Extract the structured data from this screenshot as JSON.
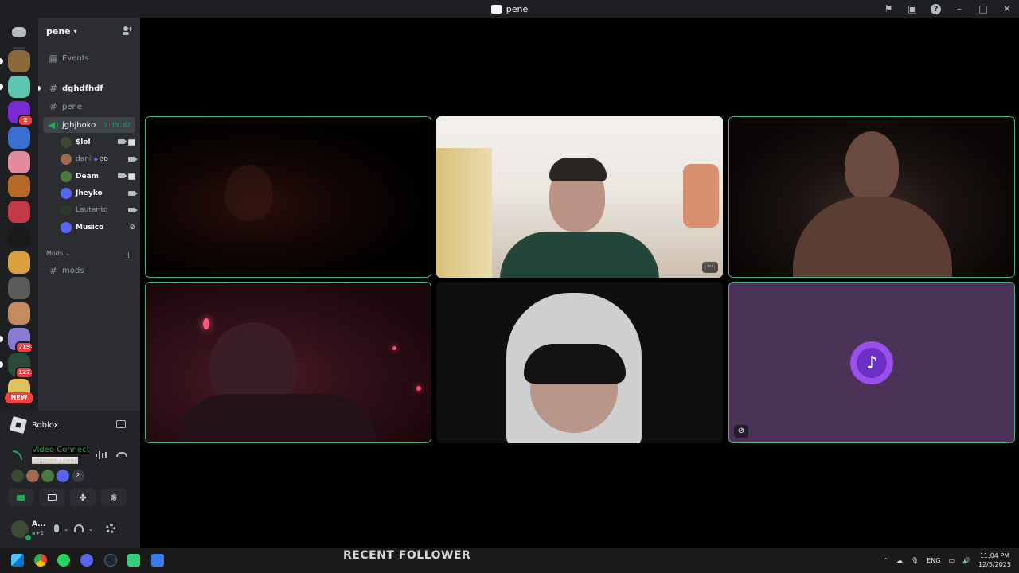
{
  "titlebar": {
    "title": "pene"
  },
  "server": {
    "name": "pene",
    "events_label": "Events",
    "channels": [
      {
        "name": "dghdfhdf",
        "type": "text",
        "unread": true
      },
      {
        "name": "pene",
        "type": "text",
        "unread": false
      },
      {
        "name": "jghjhoko",
        "type": "voice",
        "timer": "1:19:02"
      }
    ],
    "voice_users": [
      {
        "name": "$lol",
        "bold": true,
        "camera": true,
        "screen": true
      },
      {
        "name": "dani",
        "bold": false,
        "badge": "GD",
        "camera": true
      },
      {
        "name": "Deam",
        "bold": true,
        "camera": true,
        "screen": true
      },
      {
        "name": "Jheyko",
        "bold": true,
        "camera": true
      },
      {
        "name": "Lautarito",
        "bold": false,
        "camera": true
      },
      {
        "name": "Musico",
        "bold": true,
        "activity": true
      }
    ],
    "category": "Mods",
    "category_channels": [
      {
        "name": "mods"
      }
    ]
  },
  "servers": [
    {
      "color": "#8a6a3a"
    },
    {
      "color": "#5fc4b0"
    },
    {
      "color": "#7a2ad4",
      "badge": "2"
    },
    {
      "color": "#3a6fd0"
    },
    {
      "color": "#e38aa0"
    },
    {
      "color": "#b56a2a"
    },
    {
      "color": "#c23a4a"
    },
    {
      "color": "#1a1a1a"
    },
    {
      "color": "#d8a040"
    },
    {
      "color": "#5a5a5a"
    },
    {
      "color": "#c48a60"
    },
    {
      "color": "#8a7ad0",
      "badge": "719"
    },
    {
      "color": "#2a4a3a",
      "badge": "127"
    },
    {
      "color": "#e0c060"
    }
  ],
  "new_badge": "NEW",
  "activity": {
    "game": "Roblox"
  },
  "voice_panel": {
    "status": "Video Connected",
    "location": "jghjhoko / pene"
  },
  "user": {
    "name": "A...",
    "status": "+1"
  },
  "taskbar": {
    "overlay_text": "RECENT FOLLOWER",
    "lang": "ENG",
    "time": "11:04 PM",
    "date": "12/5/2025"
  },
  "colors": {
    "speaking": "#43b581",
    "accent": "#5865f2",
    "online": "#23a55a"
  }
}
